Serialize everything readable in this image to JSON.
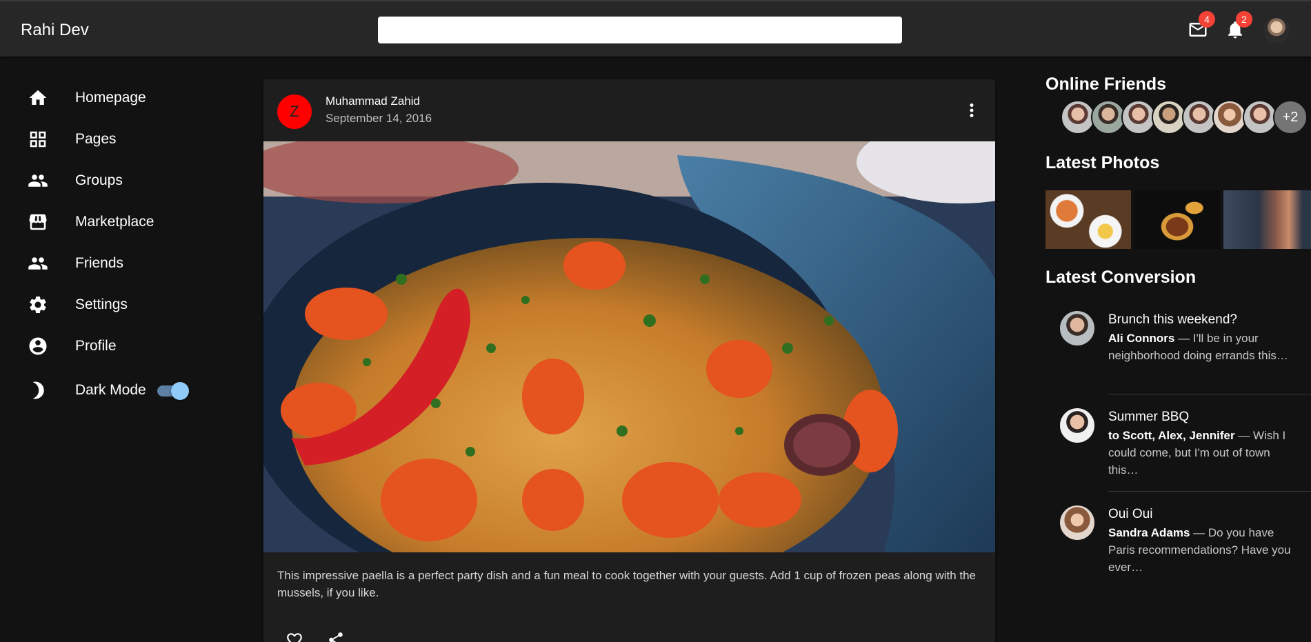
{
  "app": {
    "title": "Rahi Dev"
  },
  "search": {
    "placeholder": "",
    "value": ""
  },
  "header": {
    "mail_icon": "mail-icon",
    "mail_badge": "4",
    "notifications_icon": "bell-icon",
    "notifications_badge": "2",
    "avatar_icon": "user-avatar"
  },
  "sidebar": {
    "items": [
      {
        "label": "Homepage",
        "icon": "home-icon"
      },
      {
        "label": "Pages",
        "icon": "pages-icon"
      },
      {
        "label": "Groups",
        "icon": "groups-icon"
      },
      {
        "label": "Marketplace",
        "icon": "storefront-icon"
      },
      {
        "label": "Friends",
        "icon": "friends-icon"
      },
      {
        "label": "Settings",
        "icon": "gear-icon"
      },
      {
        "label": "Profile",
        "icon": "account-circle-icon"
      }
    ],
    "dark_mode": {
      "label": "Dark Mode",
      "icon": "moon-icon",
      "enabled": true
    }
  },
  "post": {
    "avatar_letter": "Z",
    "author": "Muhammad Zahid",
    "date": "September 14, 2016",
    "image_alt": "paella dish",
    "text": "This impressive paella is a perfect party dish and a fun meal to cook together with your guests. Add 1 cup of frozen peas along with the mussels, if you like."
  },
  "right_panel": {
    "online_friends_title": "Online Friends",
    "online_friends_more": "+2",
    "latest_photos_title": "Latest Photos",
    "latest_conversion_title": "Latest Conversion",
    "conversations": [
      {
        "title": "Brunch this weekend?",
        "from": "Ali Connors",
        "snippet": " — I'll be in your neighborhood doing errands this…"
      },
      {
        "title": "Summer BBQ",
        "from": "to Scott, Alex, Jennifer",
        "snippet": " — Wish I could come, but I'm out of town this…"
      },
      {
        "title": "Oui Oui",
        "from": "Sandra Adams",
        "snippet": " — Do you have Paris recommendations? Have you ever…"
      }
    ]
  },
  "colors": {
    "background": "#121212",
    "appbar": "#272727",
    "card": "#1e1e1e",
    "badge": "#f44336",
    "post_avatar": "#ff0000",
    "switch_thumb": "#90caf9"
  }
}
